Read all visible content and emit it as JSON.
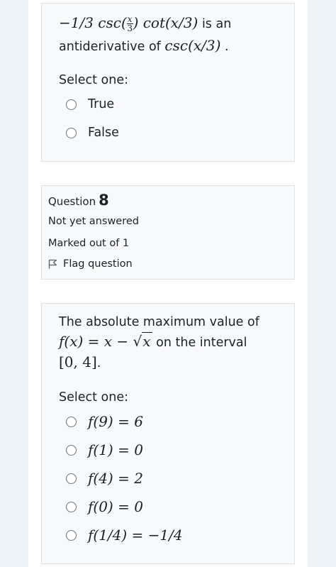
{
  "question_prev": {
    "prompt_expr_a": "−1/3 csc(",
    "frac_num": "x",
    "frac_den": "3",
    "prompt_expr_b": ") cot(x/3)",
    "prompt_text_1": "is an",
    "prompt_text_2": "antiderivative of",
    "prompt_expr_c": "csc(x/3)",
    "prompt_end": ".",
    "select_label": "Select one:",
    "options": [
      "True",
      "False"
    ]
  },
  "question_info": {
    "question_label": "Question",
    "question_number": "8",
    "status": "Not yet answered",
    "marks": "Marked out of 1",
    "flag_label": "Flag question"
  },
  "question_current": {
    "prompt_text_1": "The absolute maximum value of",
    "prompt_expr_a": "f(x) = x −",
    "sqrt_arg": "x",
    "prompt_text_2": "on the interval",
    "interval": "[0, 4]",
    "prompt_end": ".",
    "select_label": "Select one:",
    "options": [
      "f(9) = 6",
      "f(1) = 0",
      "f(4) = 2",
      "f(0) = 0",
      "f(1/4) = −1/4"
    ]
  }
}
